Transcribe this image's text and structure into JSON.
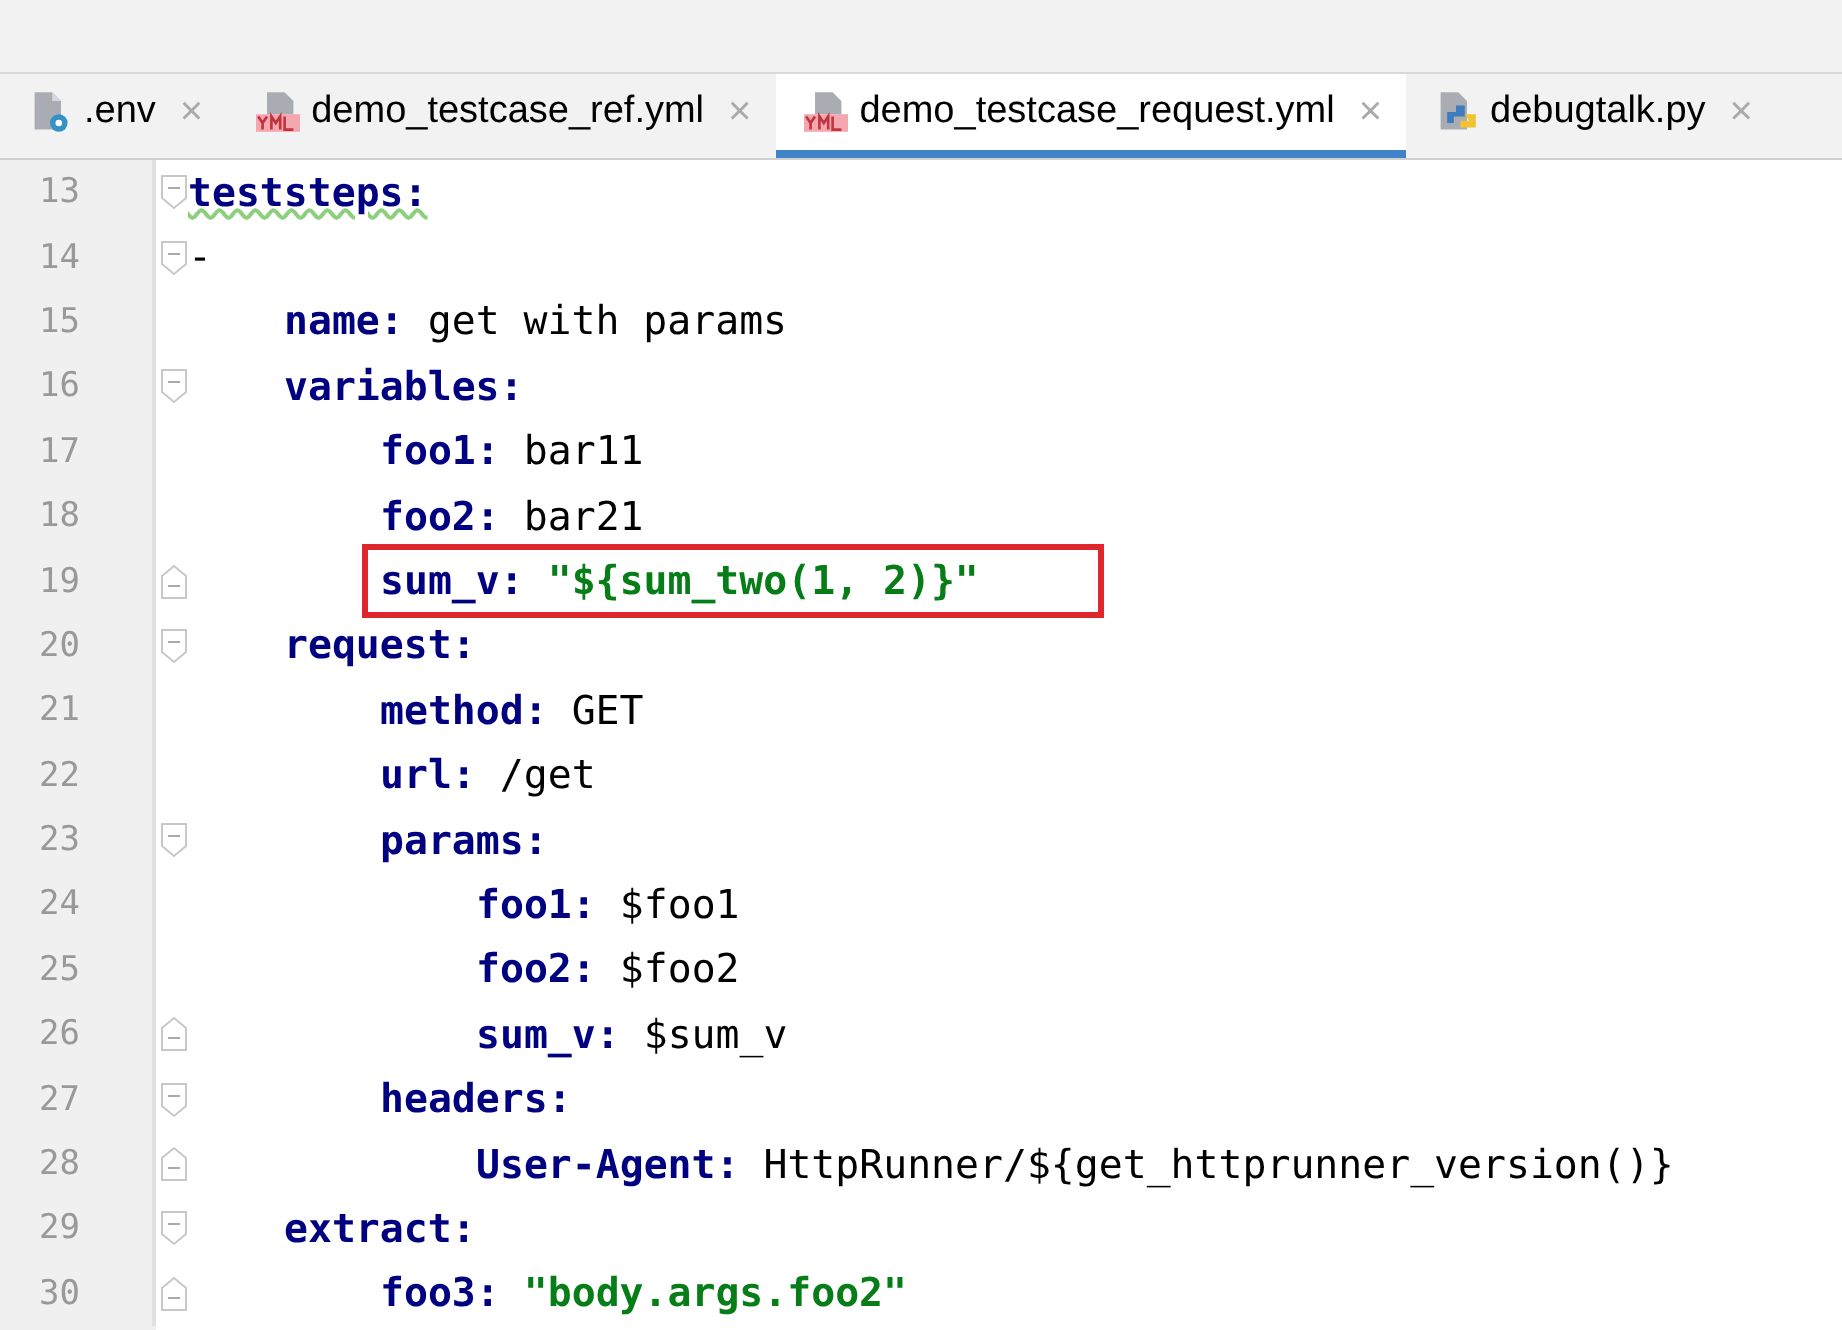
{
  "tabs": [
    {
      "label": ".env",
      "kind": "settings",
      "selected": false,
      "close": "×"
    },
    {
      "label": "demo_testcase_ref.yml",
      "kind": "yaml",
      "selected": false,
      "close": "×"
    },
    {
      "label": "demo_testcase_request.yml",
      "kind": "yaml",
      "selected": true,
      "close": "×"
    },
    {
      "label": "debugtalk.py",
      "kind": "python",
      "selected": false,
      "close": "×"
    }
  ],
  "editor": {
    "lines": [
      {
        "number": "13",
        "fold_start": true,
        "fold_end": false,
        "key": "teststeps:",
        "underlined": true
      },
      {
        "number": "14",
        "fold_start": true,
        "fold_end": false,
        "value": "-",
        "kind": "plain",
        "children": [
          {
            "number": "15",
            "fold_start": false,
            "fold_end": false,
            "key": "name:",
            "value": "get with params",
            "kind": "plain"
          },
          {
            "number": "16",
            "fold_start": true,
            "fold_end": false,
            "key": "variables:",
            "children": [
              {
                "number": "17",
                "fold_start": false,
                "fold_end": false,
                "key": "foo1:",
                "value": "bar11",
                "kind": "plain"
              },
              {
                "number": "18",
                "fold_start": false,
                "fold_end": false,
                "key": "foo2:",
                "value": "bar21",
                "kind": "plain"
              },
              {
                "number": "19",
                "fold_start": false,
                "fold_end": true,
                "key": "sum_v:",
                "value": "\"${sum_two(1, 2)}\"",
                "kind": "string",
                "highlighted": true
              }
            ]
          },
          {
            "number": "20",
            "fold_start": true,
            "fold_end": false,
            "key": "request:",
            "children": [
              {
                "number": "21",
                "fold_start": false,
                "fold_end": false,
                "key": "method:",
                "value": "GET",
                "kind": "plain"
              },
              {
                "number": "22",
                "fold_start": false,
                "fold_end": false,
                "key": "url:",
                "value": "/get",
                "kind": "plain"
              },
              {
                "number": "23",
                "fold_start": true,
                "fold_end": false,
                "key": "params:",
                "children": [
                  {
                    "number": "24",
                    "fold_start": false,
                    "fold_end": false,
                    "key": "foo1:",
                    "value": "$foo1",
                    "kind": "plain"
                  },
                  {
                    "number": "25",
                    "fold_start": false,
                    "fold_end": false,
                    "key": "foo2:",
                    "value": "$foo2",
                    "kind": "plain"
                  },
                  {
                    "number": "26",
                    "fold_start": false,
                    "fold_end": true,
                    "key": "sum_v:",
                    "value": "$sum_v",
                    "kind": "plain"
                  }
                ]
              },
              {
                "number": "27",
                "fold_start": true,
                "fold_end": false,
                "key": "headers:",
                "children": [
                  {
                    "number": "28",
                    "fold_start": false,
                    "fold_end": true,
                    "key": "User-Agent:",
                    "value": "HttpRunner/${get_httprunner_version()}",
                    "kind": "plain"
                  }
                ]
              }
            ]
          },
          {
            "number": "29",
            "fold_start": true,
            "fold_end": false,
            "key": "extract:",
            "children": [
              {
                "number": "30",
                "fold_start": false,
                "fold_end": true,
                "key": "foo3:",
                "value": "\"body.args.foo2\"",
                "kind": "string"
              }
            ]
          }
        ]
      }
    ]
  }
}
